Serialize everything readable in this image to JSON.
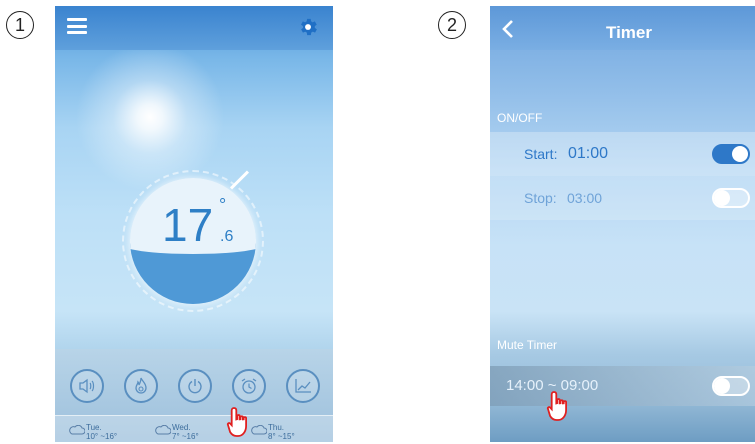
{
  "steps": {
    "first": "1",
    "second": "2"
  },
  "screen1": {
    "temperature": {
      "whole": "17",
      "degree": "°",
      "decimal": ".6"
    },
    "buttons": [
      "sound-icon",
      "flame-icon",
      "power-icon",
      "alarm-clock-icon",
      "chart-icon"
    ],
    "forecast": [
      {
        "day": "Tue.",
        "range": "10° ~16°"
      },
      {
        "day": "Wed.",
        "range": "7° ~16°"
      },
      {
        "day": "Thu.",
        "range": "8° ~15°"
      }
    ]
  },
  "screen2": {
    "title": "Timer",
    "onoff_label": "ON/OFF",
    "start": {
      "label": "Start:",
      "value": "01:00",
      "enabled": true
    },
    "stop": {
      "label": "Stop:",
      "value": "03:00",
      "enabled": false
    },
    "mute_label": "Mute Timer",
    "mute": {
      "range": "14:00 ~ 09:00",
      "enabled": false
    }
  },
  "colors": {
    "accent": "#2e78c8",
    "pointer": "#e02020"
  }
}
